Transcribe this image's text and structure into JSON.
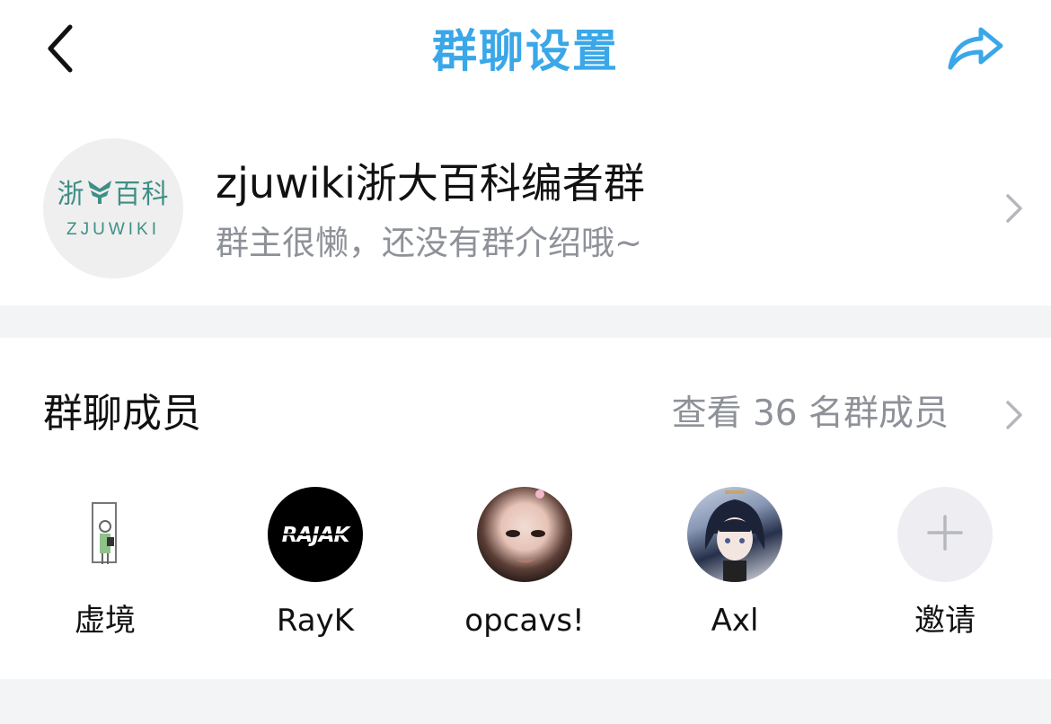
{
  "nav": {
    "title": "群聊设置",
    "back_icon": "chevron-left-icon",
    "share_icon": "share-arrow-icon",
    "accent_color": "#3aa7e8"
  },
  "group": {
    "name": "zjuwiki浙大百科编者群",
    "description": "群主很懒，还没有群介绍哦~",
    "avatar": {
      "logo_cn_left": "浙",
      "logo_cn_right": "百科",
      "logo_en": "ZJUWIKI"
    }
  },
  "members": {
    "section_title": "群聊成员",
    "view_all_label": "查看 36 名群成员",
    "list": [
      {
        "name": "虚境"
      },
      {
        "name": "RayK",
        "avatar_text": "RAJAK"
      },
      {
        "name": "opcavs!"
      },
      {
        "name": "Axl"
      }
    ],
    "invite_label": "邀请",
    "invite_icon": "plus-icon"
  }
}
